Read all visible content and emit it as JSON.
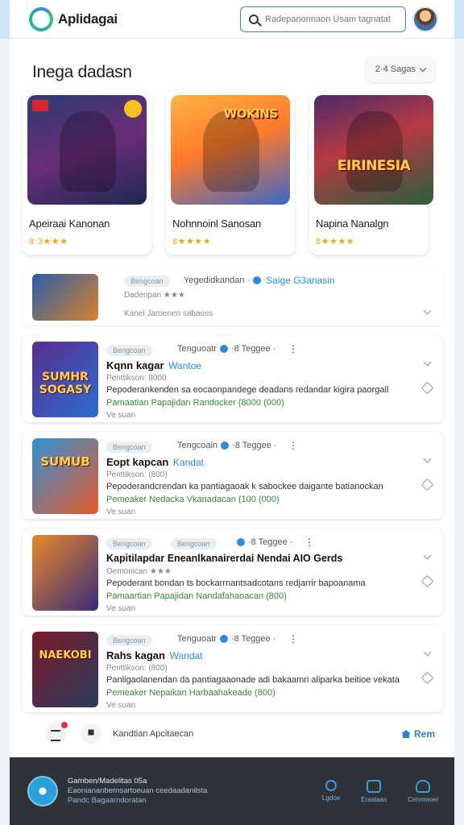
{
  "app": {
    "name": "Aplidagai"
  },
  "search": {
    "placeholder": "Radepanonnaon Usam tagnatat"
  },
  "section": {
    "title": "Inega dadasn",
    "sort_label": "2·4 Sagas"
  },
  "featured": [
    {
      "title": "Apeiraai Kanonan",
      "art_word": "",
      "stars": "8·3★★★"
    },
    {
      "title": "Nohnnoinl Sanosan",
      "art_word": "WOKINS",
      "stars": "8★★★★"
    },
    {
      "title": "Napina Nanalgn",
      "art_word": "EIRINESIA",
      "stars": "8★★★★"
    }
  ],
  "list": {
    "first": {
      "chip": "Bengcoan",
      "meta": "Yegedidkandan ·",
      "tag": "Saige G3anasin",
      "line1": "Dadenpan ★★★",
      "line2": "Kanel Jaroenen sabaoss"
    },
    "items": [
      {
        "thumb_word": "SUMHR SOGASY",
        "chip": "Bengcoan",
        "chip2": "",
        "meta": "Tenguoatr",
        "meta2": "·8 Teggee ·",
        "title": "Kqnn kagar",
        "tag": "Wantoe",
        "sub": "Penttikson: 8000",
        "desc": "Pepoderankenden sa eocaonpandege deadans redandar kigira paorgall",
        "green": "Pamaatian Papajidan Randocker (8000  (000)",
        "grey": "Ve suan"
      },
      {
        "thumb_word": "SUMUB",
        "chip": "Bengcoan",
        "chip2": "",
        "meta": "Tengcoain",
        "meta2": "·8 Teggee ·",
        "title": "Eopt kapcan",
        "tag": "Kandat",
        "sub": "Penttikson: (800)",
        "desc": "Pepoderandcrendan ka pantiagaoak k sabockee daigante batianockan",
        "green": "Pemeaker Nedacka Vkanadacan  (100  (000)",
        "grey": "Ve suan"
      },
      {
        "thumb_word": "",
        "chip": "Bengcoan",
        "chip2": "Bengcoan",
        "meta": "",
        "meta2": "·8 Teggee ·",
        "title": "Kapitilapdar Eneanlkanairerdai Nendai AIO Gerds",
        "tag": "",
        "sub": "Oemonican ★★★",
        "desc": "Pepoderant bondan ts bockarrnantsadcotans redjarrir bapoanama",
        "green": "Pamaartian Papajidan Nandafahaoacan  (800)",
        "grey": "Ve suan"
      },
      {
        "thumb_word": "NAEKOBI",
        "chip": "Bengcoan",
        "chip2": "",
        "meta": "Tenguoatr",
        "meta2": "·8 Teggee ·",
        "title": "Rahs kagan",
        "tag": "Wandat",
        "sub": "Penttikson: (800)",
        "desc": "Panligaolanendan da pantiagaaonade adi bakaamri aliparka beitioe vekata",
        "green": "Pemeaker Nepaikan Harbaahakeade  (800)",
        "grey": "Ve suan"
      }
    ]
  },
  "toolbar": {
    "label": "Kandtian Apcitaecan",
    "link": "Rem"
  },
  "footer": {
    "line1": "Gamben/Madelitas 05a",
    "line2": "Eaoniananbernsartoeuan ceedaadanilsta",
    "line3": "Pandc  Bagaarndoratan",
    "nav": [
      "Lgdoe",
      "Eraataas",
      "Cenmwoei"
    ]
  },
  "colors": {
    "accent": "#2a8be4",
    "footer_bg": "#2f3238",
    "green_text": "#2f8f2f",
    "star": "#f0a31b"
  }
}
